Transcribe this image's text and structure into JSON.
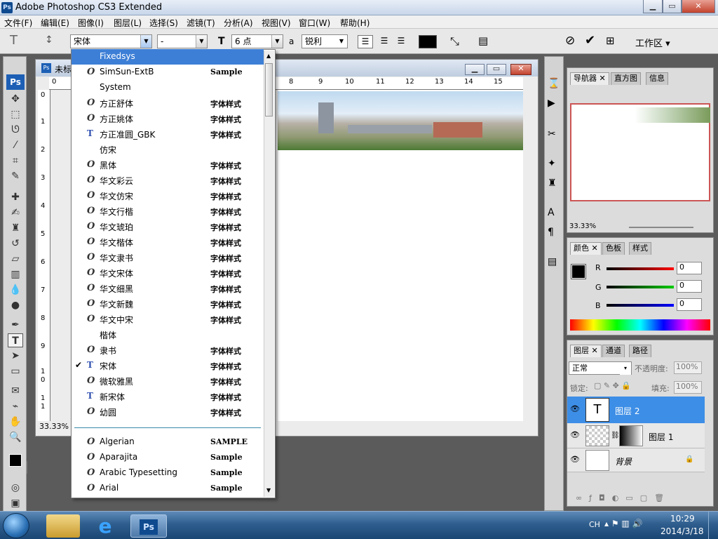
{
  "window": {
    "title": "Adobe Photoshop CS3 Extended",
    "logo": "Ps",
    "min_glyph": "▁",
    "max_glyph": "▭",
    "close_glyph": "✕"
  },
  "menubar": [
    "文件(F)",
    "编辑(E)",
    "图像(I)",
    "图层(L)",
    "选择(S)",
    "滤镜(T)",
    "分析(A)",
    "视图(V)",
    "窗口(W)",
    "帮助(H)"
  ],
  "options": {
    "font_family": "宋体",
    "font_style": "-",
    "font_size": "6 点",
    "aa_label": "a",
    "anti_alias": "锐利",
    "workspace": "工作区",
    "color_swatch": "#000000"
  },
  "document": {
    "tab_title": "未标",
    "zoom": "33.33%",
    "top_ruler": [
      "0",
      "8",
      "9",
      "10",
      "11",
      "12",
      "13",
      "14",
      "15"
    ],
    "left_ruler": [
      "0",
      "1",
      "2",
      "3",
      "4",
      "5",
      "6",
      "7",
      "8",
      "9",
      "1",
      "0",
      "1",
      "1"
    ]
  },
  "font_list": [
    {
      "name": "Fixedsys",
      "icon": "",
      "sample": "",
      "highlighted": true
    },
    {
      "name": "SimSun-ExtB",
      "icon": "O",
      "sample": "Sample"
    },
    {
      "name": "System",
      "icon": "",
      "sample": ""
    },
    {
      "name": "方正舒体",
      "icon": "O",
      "sample": "字体样式"
    },
    {
      "name": "方正姚体",
      "icon": "O",
      "sample": "字体样式"
    },
    {
      "name": "方正准圆_GBK",
      "icon": "T",
      "sample": "字体样式"
    },
    {
      "name": "仿宋",
      "icon": "",
      "sample": ""
    },
    {
      "name": "黑体",
      "icon": "O",
      "sample": "字体样式"
    },
    {
      "name": "华文彩云",
      "icon": "O",
      "sample": "字体样式"
    },
    {
      "name": "华文仿宋",
      "icon": "O",
      "sample": "字体样式"
    },
    {
      "name": "华文行楷",
      "icon": "O",
      "sample": "字体样式"
    },
    {
      "name": "华文琥珀",
      "icon": "O",
      "sample": "字体样式"
    },
    {
      "name": "华文楷体",
      "icon": "O",
      "sample": "字体样式"
    },
    {
      "name": "华文隶书",
      "icon": "O",
      "sample": "字体样式"
    },
    {
      "name": "华文宋体",
      "icon": "O",
      "sample": "字体样式"
    },
    {
      "name": "华文细黑",
      "icon": "O",
      "sample": "字体样式"
    },
    {
      "name": "华文新魏",
      "icon": "O",
      "sample": "字体样式"
    },
    {
      "name": "华文中宋",
      "icon": "O",
      "sample": "字体样式"
    },
    {
      "name": "楷体",
      "icon": "",
      "sample": ""
    },
    {
      "name": "隶书",
      "icon": "O",
      "sample": "字体样式"
    },
    {
      "name": "宋体",
      "icon": "T",
      "sample": "字体样式",
      "checked": true
    },
    {
      "name": "微软雅黑",
      "icon": "O",
      "sample": "字体样式"
    },
    {
      "name": "新宋体",
      "icon": "T",
      "sample": "字体样式"
    },
    {
      "name": "幼圆",
      "icon": "O",
      "sample": "字体样式"
    }
  ],
  "font_list_latin": [
    {
      "name": "Algerian",
      "icon": "O",
      "sample": "SAMPLE"
    },
    {
      "name": "Aparajita",
      "icon": "O",
      "sample": "Sample"
    },
    {
      "name": "Arabic Typesetting",
      "icon": "O",
      "sample": "Sample"
    },
    {
      "name": "Arial",
      "icon": "O",
      "sample": "Sample"
    }
  ],
  "check_glyph": "✔",
  "navigator": {
    "tabs": [
      "导航器",
      "直方图",
      "信息"
    ],
    "zoom": "33.33%"
  },
  "color_panel": {
    "tabs": [
      "颜色",
      "色板",
      "样式"
    ],
    "channels": [
      {
        "label": "R",
        "value": "0"
      },
      {
        "label": "G",
        "value": "0"
      },
      {
        "label": "B",
        "value": "0"
      }
    ]
  },
  "layers": {
    "tabs": [
      "图层",
      "通道",
      "路径"
    ],
    "blend_mode": "正常",
    "opacity_label": "不透明度:",
    "opacity": "100%",
    "lock_label": "锁定:",
    "fill_label": "填充:",
    "fill": "100%",
    "items": [
      {
        "name": "图层 2",
        "thumb": "T",
        "selected": true
      },
      {
        "name": "图层 1",
        "thumb": ""
      },
      {
        "name": "背景",
        "thumb": ""
      }
    ]
  },
  "taskbar": {
    "lang": "CH",
    "time": "10:29",
    "date": "2014/3/18",
    "ps_label": "Ps"
  }
}
